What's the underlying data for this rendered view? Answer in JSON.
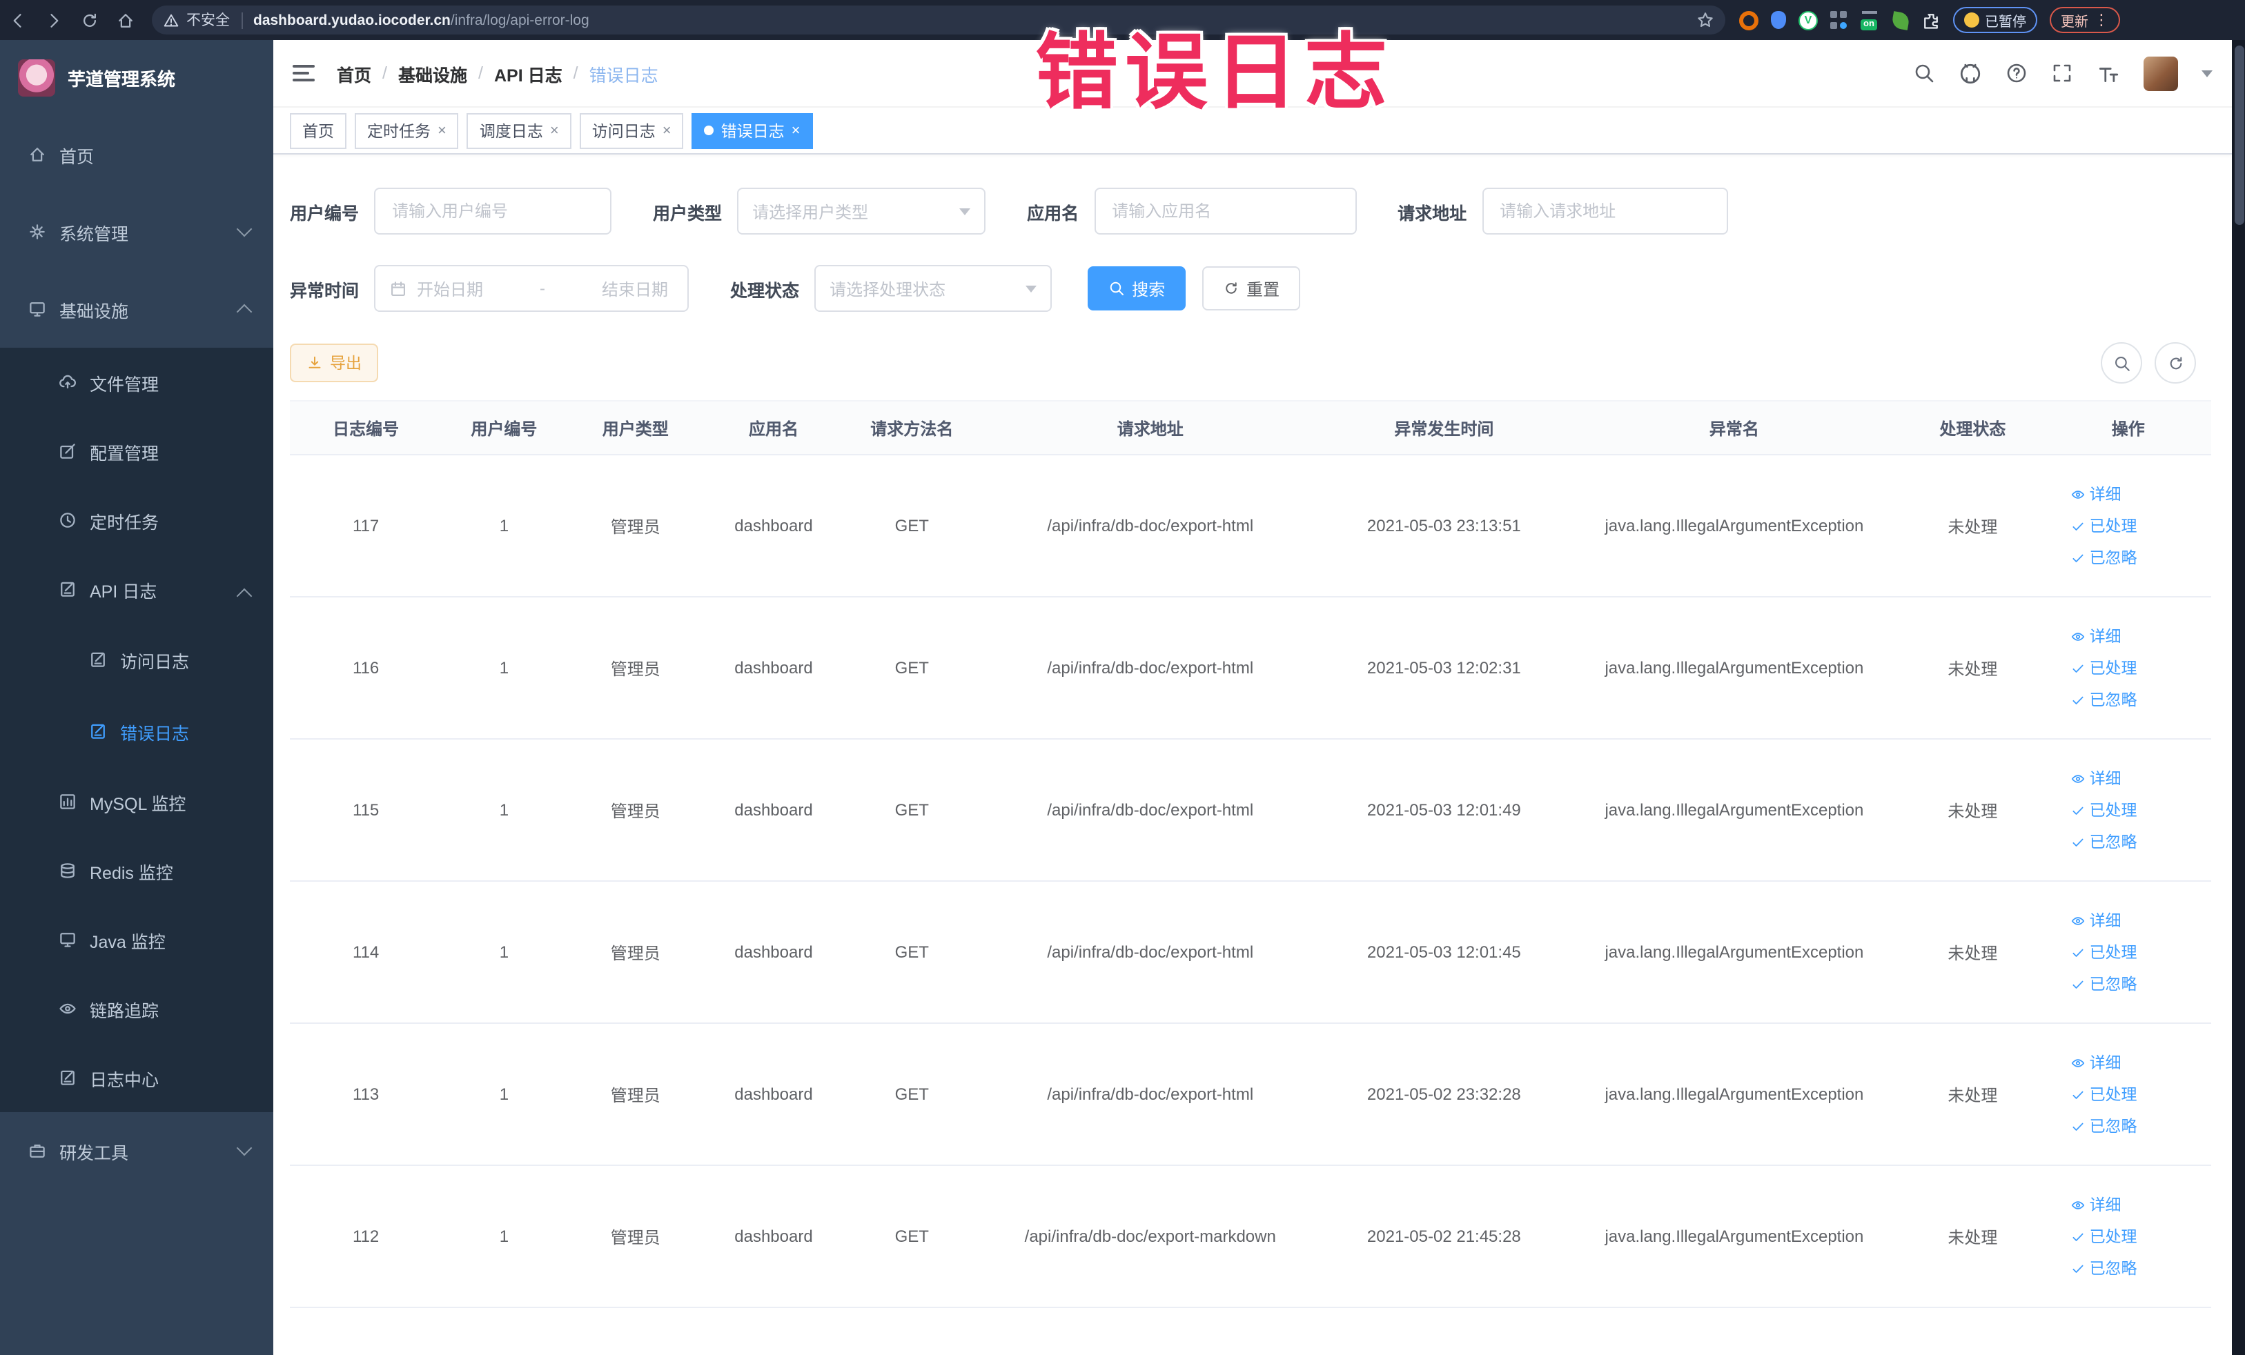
{
  "browser": {
    "security_text": "不安全",
    "url_host": "dashboard.yudao.iocoder.cn",
    "url_path": "/infra/log/api-error-log",
    "on_badge": "on",
    "paused_label": "已暂停",
    "update_label": "更新"
  },
  "overlay_title": "错误日志",
  "sidebar": {
    "app_title": "芋道管理系统",
    "items": [
      {
        "label": "首页",
        "icon": "home",
        "level": 1
      },
      {
        "label": "系统管理",
        "icon": "gear",
        "level": 1,
        "arrow": "down"
      },
      {
        "label": "基础设施",
        "icon": "monitor",
        "level": 1,
        "arrow": "up"
      },
      {
        "label": "文件管理",
        "icon": "cloud",
        "level": 2
      },
      {
        "label": "配置管理",
        "icon": "edit",
        "level": 2
      },
      {
        "label": "定时任务",
        "icon": "clock",
        "level": 2
      },
      {
        "label": "API 日志",
        "icon": "log",
        "level": 2,
        "arrow": "up"
      },
      {
        "label": "访问日志",
        "icon": "log",
        "level": 3
      },
      {
        "label": "错误日志",
        "icon": "log",
        "level": 3,
        "active": true
      },
      {
        "label": "MySQL 监控",
        "icon": "chart",
        "level": 2
      },
      {
        "label": "Redis 监控",
        "icon": "stack",
        "level": 2
      },
      {
        "label": "Java 监控",
        "icon": "monitor",
        "level": 2
      },
      {
        "label": "链路追踪",
        "icon": "eye",
        "level": 2
      },
      {
        "label": "日志中心",
        "icon": "log",
        "level": 2
      },
      {
        "label": "研发工具",
        "icon": "tool",
        "level": 1,
        "arrow": "down"
      }
    ]
  },
  "breadcrumb": [
    "首页",
    "基础设施",
    "API 日志",
    "错误日志"
  ],
  "tabs": [
    {
      "label": "首页",
      "closable": false,
      "active": false
    },
    {
      "label": "定时任务",
      "closable": true,
      "active": false
    },
    {
      "label": "调度日志",
      "closable": true,
      "active": false
    },
    {
      "label": "访问日志",
      "closable": true,
      "active": false
    },
    {
      "label": "错误日志",
      "closable": true,
      "active": true
    }
  ],
  "filters": {
    "user_id_label": "用户编号",
    "user_id_placeholder": "请输入用户编号",
    "user_type_label": "用户类型",
    "user_type_placeholder": "请选择用户类型",
    "app_name_label": "应用名",
    "app_name_placeholder": "请输入应用名",
    "request_url_label": "请求地址",
    "request_url_placeholder": "请输入请求地址",
    "exception_time_label": "异常时间",
    "start_date_placeholder": "开始日期",
    "range_separator": "-",
    "end_date_placeholder": "结束日期",
    "process_status_label": "处理状态",
    "process_status_placeholder": "请选择处理状态",
    "search_button": "搜索",
    "reset_button": "重置"
  },
  "toolbar": {
    "export_label": "导出"
  },
  "table": {
    "columns": [
      "日志编号",
      "用户编号",
      "用户类型",
      "应用名",
      "请求方法名",
      "请求地址",
      "异常发生时间",
      "异常名",
      "处理状态",
      "操作"
    ],
    "action_labels": [
      "详细",
      "已处理",
      "已忽略"
    ],
    "rows": [
      {
        "id": "117",
        "user_id": "1",
        "user_type": "管理员",
        "app": "dashboard",
        "method": "GET",
        "url": "/api/infra/db-doc/export-html",
        "time": "2021-05-03 23:13:51",
        "exception": "java.lang.IllegalArgumentException",
        "status": "未处理"
      },
      {
        "id": "116",
        "user_id": "1",
        "user_type": "管理员",
        "app": "dashboard",
        "method": "GET",
        "url": "/api/infra/db-doc/export-html",
        "time": "2021-05-03 12:02:31",
        "exception": "java.lang.IllegalArgumentException",
        "status": "未处理"
      },
      {
        "id": "115",
        "user_id": "1",
        "user_type": "管理员",
        "app": "dashboard",
        "method": "GET",
        "url": "/api/infra/db-doc/export-html",
        "time": "2021-05-03 12:01:49",
        "exception": "java.lang.IllegalArgumentException",
        "status": "未处理"
      },
      {
        "id": "114",
        "user_id": "1",
        "user_type": "管理员",
        "app": "dashboard",
        "method": "GET",
        "url": "/api/infra/db-doc/export-html",
        "time": "2021-05-03 12:01:45",
        "exception": "java.lang.IllegalArgumentException",
        "status": "未处理"
      },
      {
        "id": "113",
        "user_id": "1",
        "user_type": "管理员",
        "app": "dashboard",
        "method": "GET",
        "url": "/api/infra/db-doc/export-html",
        "time": "2021-05-02 23:32:28",
        "exception": "java.lang.IllegalArgumentException",
        "status": "未处理"
      },
      {
        "id": "112",
        "user_id": "1",
        "user_type": "管理员",
        "app": "dashboard",
        "method": "GET",
        "url": "/api/infra/db-doc/export-markdown",
        "time": "2021-05-02 21:45:28",
        "exception": "java.lang.IllegalArgumentException",
        "status": "未处理"
      }
    ]
  },
  "colors": {
    "accent_blue": "#409eff",
    "warning_orange": "#e6a23c",
    "sidebar_bg": "#304156",
    "submenu_bg": "#1f2d3d",
    "overlay_pink": "#ee2d5d",
    "chrome_bg": "#1d2433"
  }
}
